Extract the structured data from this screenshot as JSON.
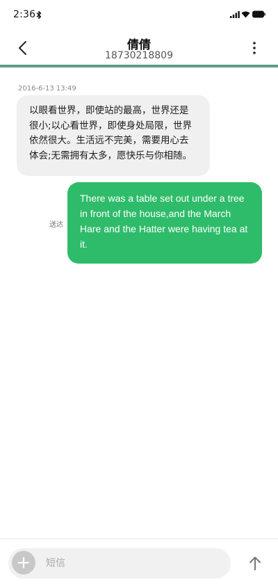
{
  "status_bar": {
    "time": "2:36"
  },
  "header": {
    "contact_name": "倩倩",
    "contact_number": "18730218809"
  },
  "conversation": {
    "timestamp": "2016-6-13 13:49",
    "messages": [
      {
        "direction": "incoming",
        "text": "以眼看世界，即使站的最高，世界还是很小;以心看世界，即使身处局限，世界依然很大。生活远不完美，需要用心去体会;无需拥有太多，愿快乐与你相随。"
      },
      {
        "direction": "outgoing",
        "text": "There was a table set out under a tree in front of the house,and the March Hare and the Hatter were having tea at it.",
        "status": "送达"
      }
    ]
  },
  "composer": {
    "placeholder": "短信",
    "value": ""
  },
  "icons": {
    "status": [
      "bluetooth-icon",
      "signal-icon",
      "wifi-icon",
      "battery-icon"
    ],
    "header": [
      "back-arrow-icon",
      "more-vertical-icon"
    ],
    "composer": [
      "plus-icon",
      "send-arrow-up-icon"
    ]
  },
  "colors": {
    "accent_divider": "#5f9c8a",
    "outgoing_bubble": "#2fbc6a",
    "incoming_bubble": "#f0f0f0"
  }
}
